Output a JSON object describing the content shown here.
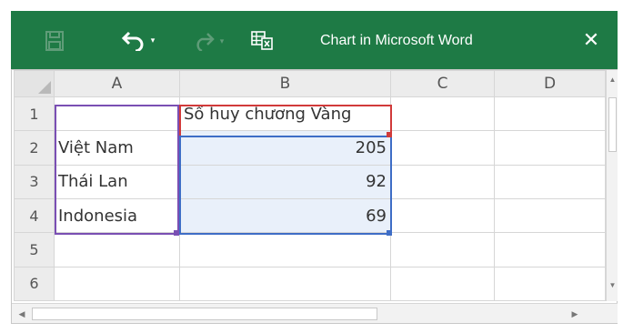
{
  "window": {
    "title": "Chart in Microsoft Word",
    "close_glyph": "✕",
    "accent": "#1e7a45"
  },
  "toolbar": {
    "save_icon": "save-icon",
    "undo_icon": "undo-icon",
    "redo_icon": "redo-icon",
    "edit_data_icon": "edit-data-in-excel-icon",
    "caret": "▾"
  },
  "sheet": {
    "columns": [
      "A",
      "B",
      "C",
      "D"
    ],
    "rows": [
      {
        "row": "1",
        "A": "",
        "B": "Số huy chương Vàng",
        "C": "",
        "D": ""
      },
      {
        "row": "2",
        "A": "Việt Nam",
        "B": "205",
        "C": "",
        "D": ""
      },
      {
        "row": "3",
        "A": "Thái Lan",
        "B": "92",
        "C": "",
        "D": ""
      },
      {
        "row": "4",
        "A": "Indonesia",
        "B": "69",
        "C": "",
        "D": ""
      },
      {
        "row": "5",
        "A": "",
        "B": "",
        "C": "",
        "D": ""
      },
      {
        "row": "6",
        "A": "",
        "B": "",
        "C": "",
        "D": ""
      }
    ],
    "range_colors": {
      "series_name": "#d13a3a",
      "categories": "#7a4fb3",
      "values": "#3e6dc6"
    }
  },
  "scroll": {
    "up": "▲",
    "down": "▼",
    "left": "◀",
    "right": "▶"
  }
}
